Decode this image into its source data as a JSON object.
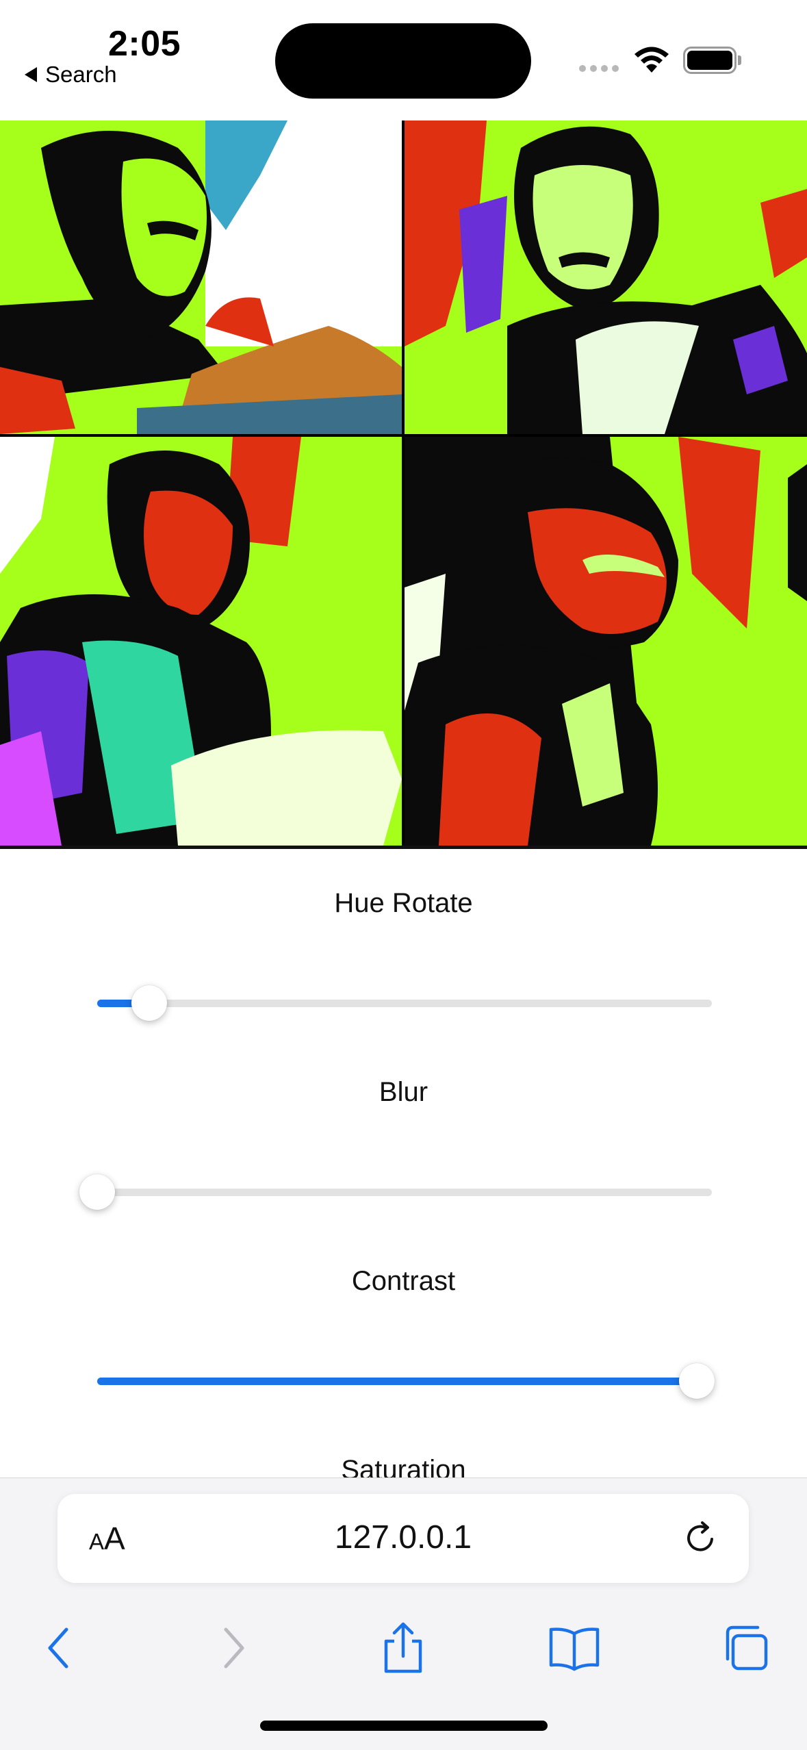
{
  "status_bar": {
    "time": "2:05",
    "back_label": "Search",
    "icons": [
      "signal-dots-icon",
      "wifi-icon",
      "battery-icon"
    ]
  },
  "gallery": {
    "images": [
      {
        "name": "portrait-1",
        "alt": ""
      },
      {
        "name": "portrait-2",
        "alt": ""
      },
      {
        "name": "portrait-3",
        "alt": ""
      },
      {
        "name": "portrait-4",
        "alt": ""
      }
    ],
    "palette": {
      "lime": "#a6ff1a",
      "red": "#e03012",
      "black": "#0b0b0b",
      "purple": "#6a2fd6"
    }
  },
  "controls": {
    "hue_rotate": {
      "label": "Hue Rotate",
      "value_fraction": 0.085
    },
    "blur": {
      "label": "Blur",
      "value_fraction": 0.0
    },
    "contrast": {
      "label": "Contrast",
      "value_fraction": 0.975
    },
    "saturation": {
      "label": "Saturation"
    }
  },
  "browser": {
    "text_size_label_small": "A",
    "text_size_label_large": "A",
    "url": "127.0.0.1",
    "accent": "#1a73e8",
    "nav_icons": [
      "back-icon",
      "forward-icon",
      "share-icon",
      "bookmarks-icon",
      "tabs-icon"
    ]
  }
}
